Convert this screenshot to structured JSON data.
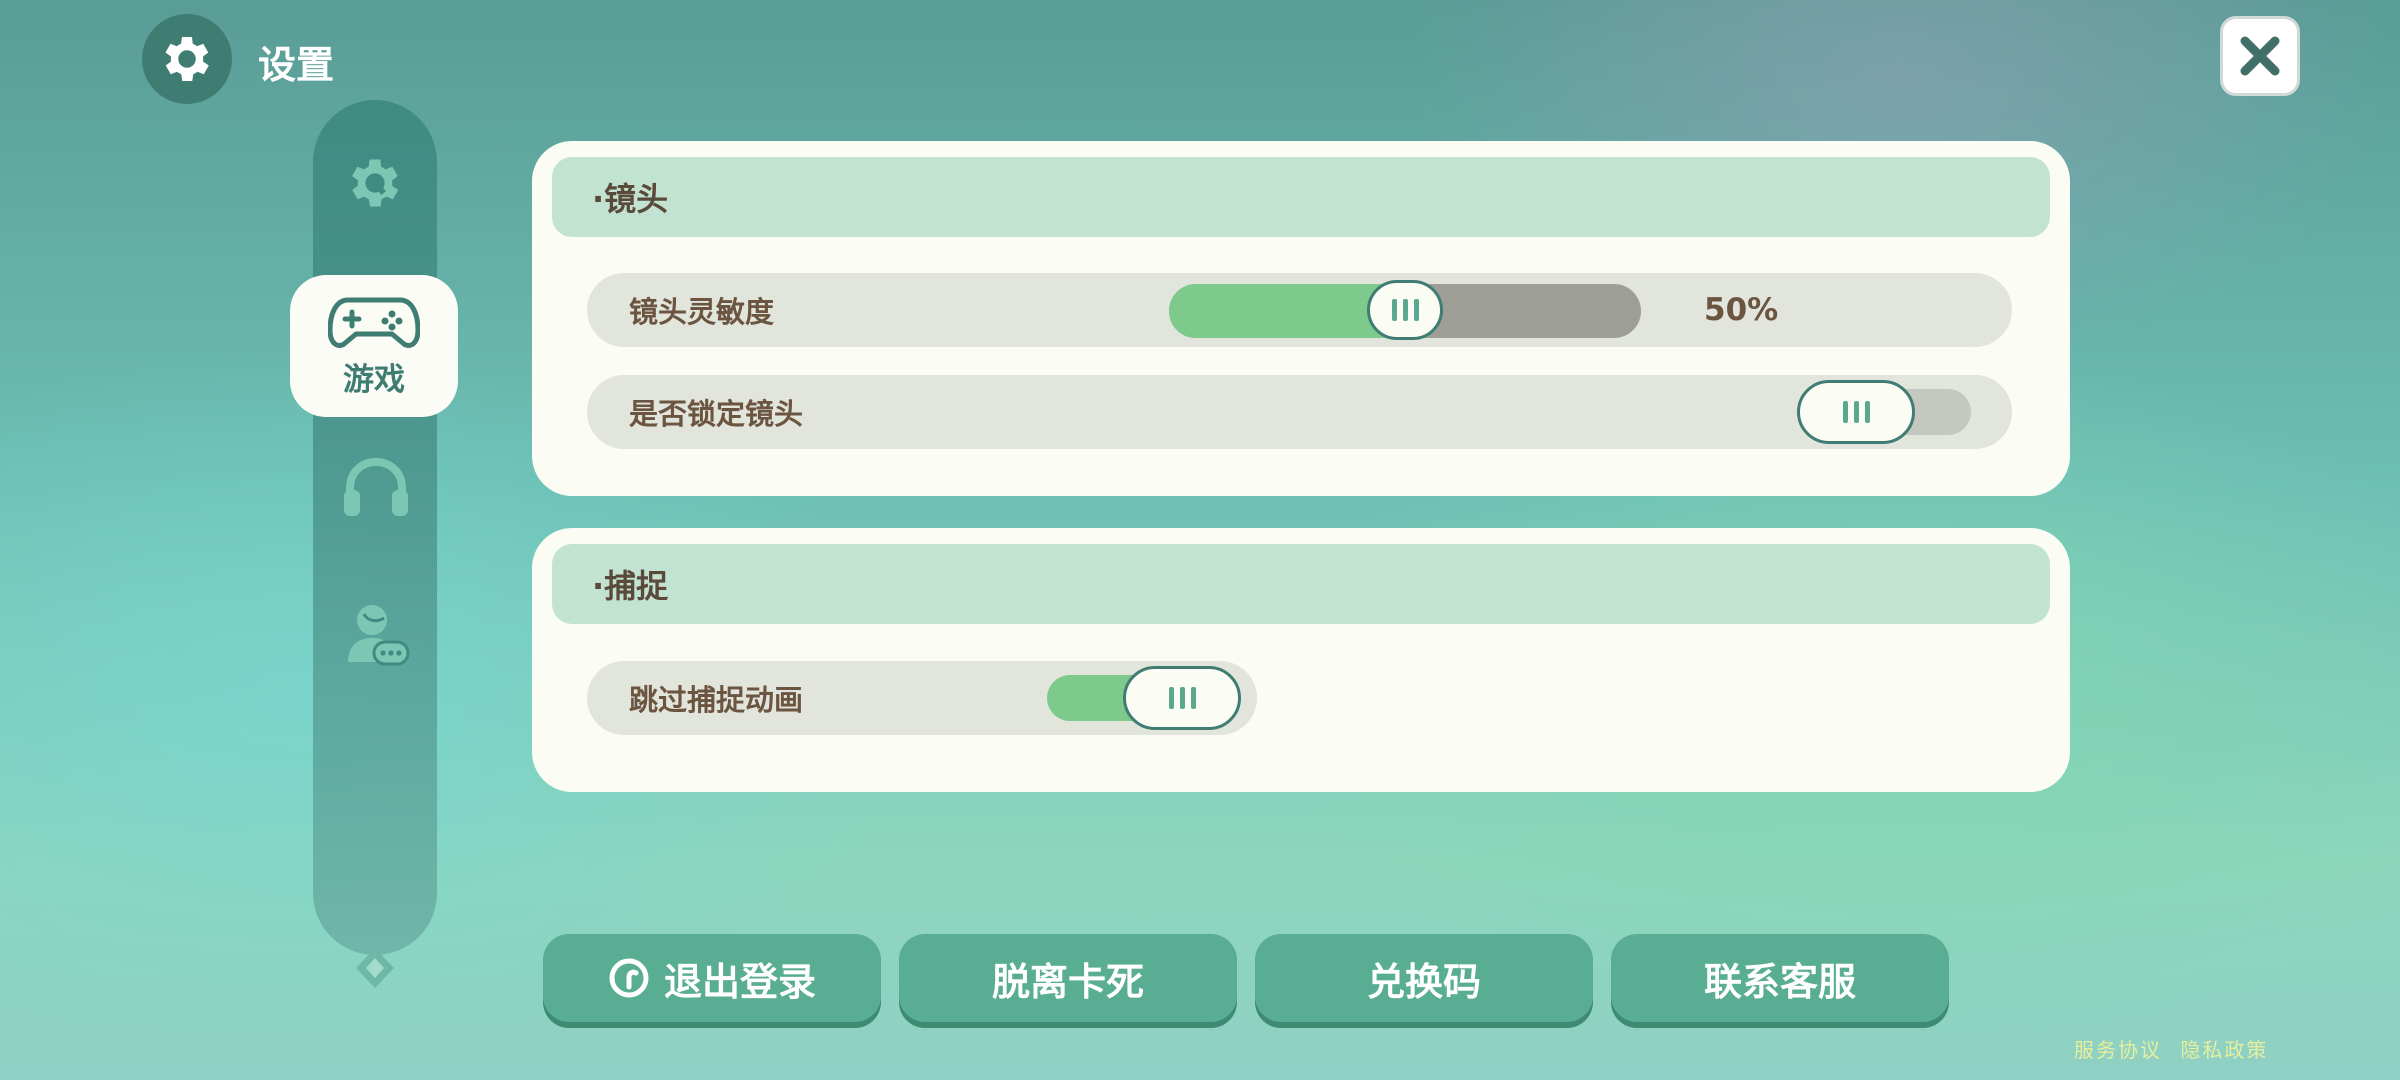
{
  "header": {
    "title": "设置",
    "icon": "gear-icon",
    "close_icon": "close-icon"
  },
  "sidebar": {
    "items": [
      {
        "icon": "gear-wrench-icon",
        "label": "",
        "active": false
      },
      {
        "icon": "gamepad-icon",
        "label": "游戏",
        "active": true
      },
      {
        "icon": "headphones-icon",
        "label": "",
        "active": false
      },
      {
        "icon": "user-chat-icon",
        "label": "",
        "active": false
      }
    ]
  },
  "camera": {
    "title": "·镜头",
    "sensitivity": {
      "label": "镜头灵敏度",
      "value": 0.5,
      "display": "50%"
    },
    "lock": {
      "label": "是否锁定镜头",
      "on": false
    }
  },
  "capture": {
    "title": "·捕捉",
    "skip_animation": {
      "label": "跳过捕捉动画",
      "on": true
    }
  },
  "buttons": {
    "logout": "退出登录",
    "unstuck": "脱离卡死",
    "redeem": "兑换码",
    "support": "联系客服"
  },
  "footer": {
    "terms": "服务协议",
    "privacy": "隐私政策"
  },
  "colors": {
    "accent": "#58ad92",
    "track_on": "#7dca8c",
    "track_off": "#9d9f97",
    "panel": "#fbfcf4"
  }
}
